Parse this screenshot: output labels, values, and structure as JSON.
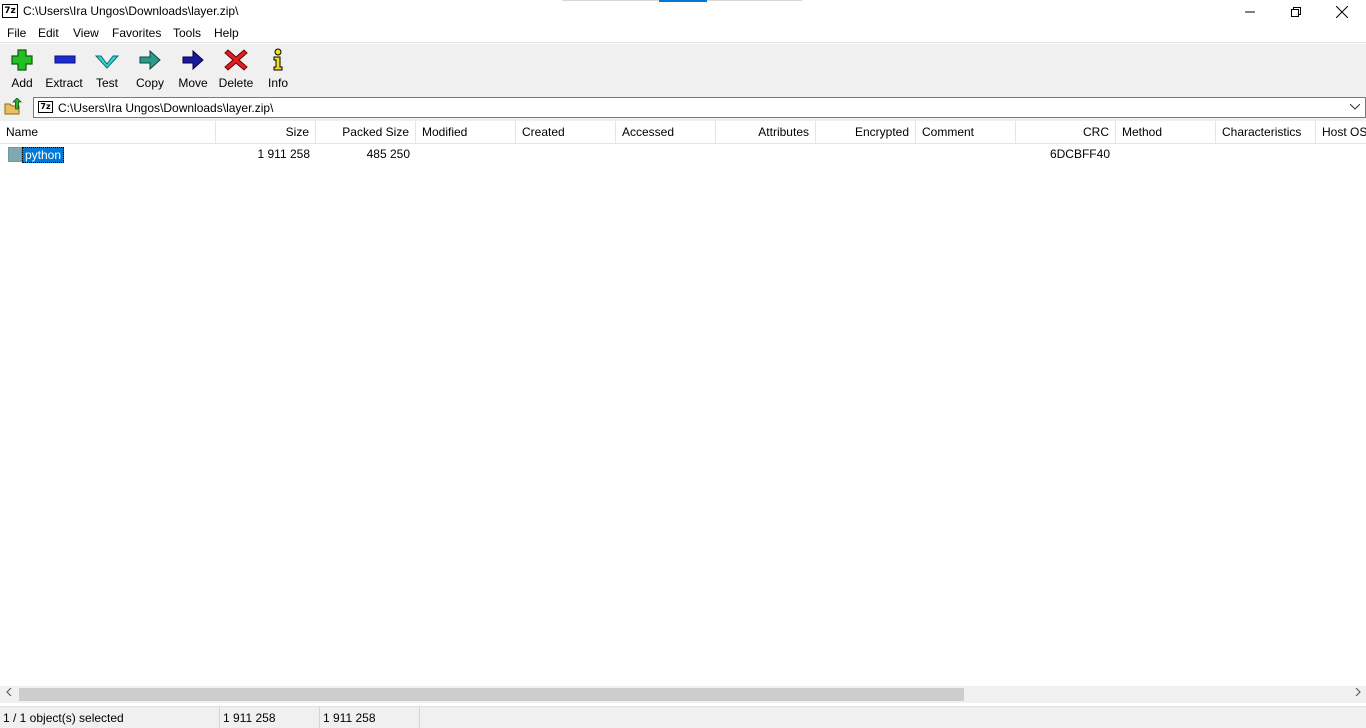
{
  "window": {
    "title": "C:\\Users\\Ira Ungos\\Downloads\\layer.zip\\",
    "app_icon_text": "7z"
  },
  "menu": [
    "File",
    "Edit",
    "View",
    "Favorites",
    "Tools",
    "Help"
  ],
  "toolbar": {
    "add": "Add",
    "extract": "Extract",
    "test": "Test",
    "copy": "Copy",
    "move": "Move",
    "delete": "Delete",
    "info": "Info"
  },
  "address": {
    "path": "C:\\Users\\Ira Ungos\\Downloads\\layer.zip\\"
  },
  "columns": {
    "name": "Name",
    "size": "Size",
    "packed_size": "Packed Size",
    "modified": "Modified",
    "created": "Created",
    "accessed": "Accessed",
    "attributes": "Attributes",
    "encrypted": "Encrypted",
    "comment": "Comment",
    "crc": "CRC",
    "method": "Method",
    "characteristics": "Characteristics",
    "host_os": "Host OS"
  },
  "rows": [
    {
      "name": "python",
      "size": "1 911 258",
      "packed_size": "485 250",
      "crc": "6DCBFF40"
    }
  ],
  "status": {
    "selected": "1 / 1 object(s) selected",
    "size1": "1 911 258",
    "size2": "1 911 258"
  },
  "colors": {
    "selection": "#0078d7",
    "toolbar_bg": "#f0f0f0"
  }
}
